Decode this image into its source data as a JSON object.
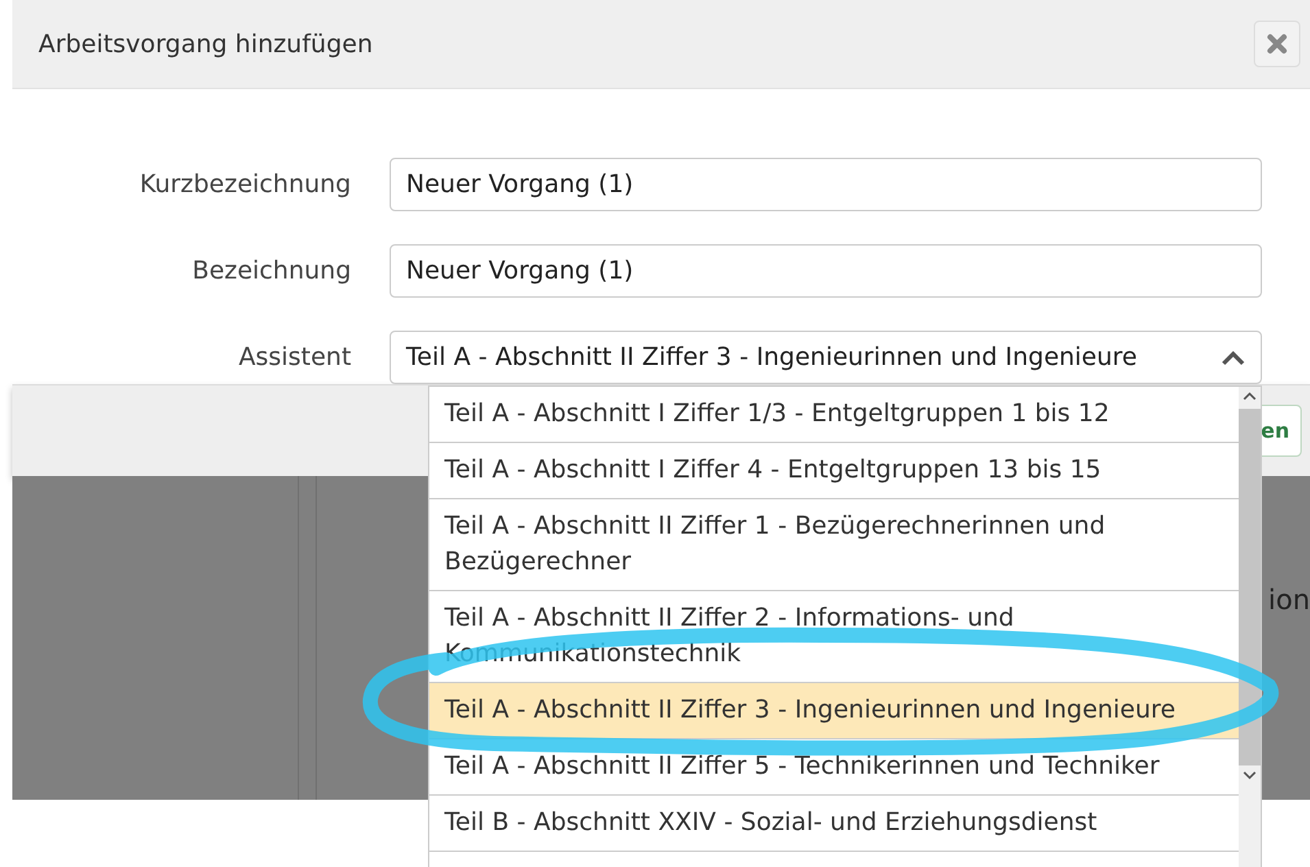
{
  "dialog": {
    "title": "Arbeitsvorgang hinzufügen"
  },
  "fields": [
    {
      "kind": "text",
      "label": "Kurzbezeichnung",
      "value": "Neuer Vorgang (1)"
    },
    {
      "kind": "text",
      "label": "Bezeichnung",
      "value": "Neuer Vorgang (1)"
    },
    {
      "kind": "select",
      "label": "Assistent",
      "value": "Teil A - Abschnitt II Ziffer 3 - Ingenieurinnen und Ingenieure",
      "expanded": true
    }
  ],
  "options": [
    {
      "label": "Teil A - Abschnitt I Ziffer 1/3 - Entgeltgruppen 1 bis 12",
      "selected": false
    },
    {
      "label": "Teil A - Abschnitt I Ziffer 4 - Entgeltgruppen 13 bis 15",
      "selected": false
    },
    {
      "label": "Teil A - Abschnitt II Ziffer 1 - Bezügerechnerinnen und Bezügerechner",
      "selected": false
    },
    {
      "label": "Teil A - Abschnitt II Ziffer 2 - Informations- und Kommunikationstechnik",
      "selected": false
    },
    {
      "label": "Teil A - Abschnitt II Ziffer 3 - Ingenieurinnen und Ingenieure",
      "selected": true
    },
    {
      "label": "Teil A - Abschnitt II Ziffer 5 - Technikerinnen und Techniker",
      "selected": false
    },
    {
      "label": "Teil B - Abschnitt XXIV - Sozial- und Erziehungsdienst",
      "selected": false
    }
  ],
  "footer_button": "en",
  "background_text": "ion"
}
